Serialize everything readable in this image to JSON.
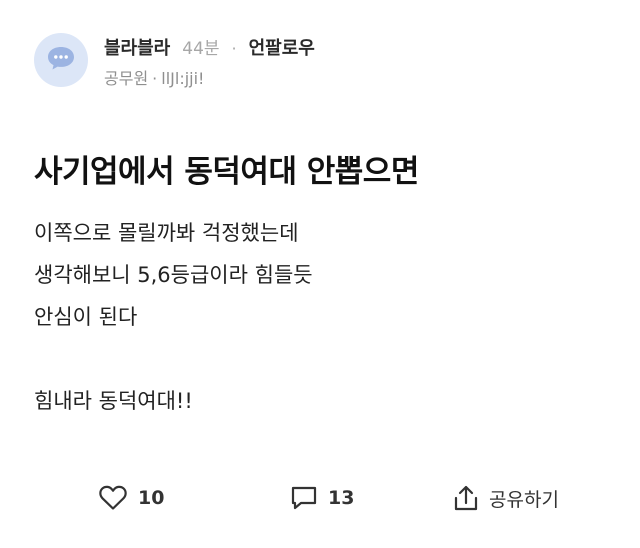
{
  "author": {
    "name": "블라블라",
    "time": "44분",
    "separator": "·",
    "unfollow_label": "언팔로우",
    "job": "공무원",
    "meta_separator": "·",
    "nickname": "llJl:jji!",
    "avatar_icon": "speech-bubble-icon",
    "avatar_color": "#dce6f7"
  },
  "post": {
    "title": "사기업에서 동덕여대 안뽑으면",
    "body_lines": [
      "이쪽으로 몰릴까봐 걱정했는데",
      "생각해보니 5,6등급이라 힘들듯",
      "안심이 된다",
      "",
      "힘내라 동덕여대!!"
    ]
  },
  "actions": {
    "like_icon": "heart-icon",
    "like_count": "10",
    "comment_icon": "comment-icon",
    "comment_count": "13",
    "share_icon": "share-icon",
    "share_label": "공유하기"
  }
}
